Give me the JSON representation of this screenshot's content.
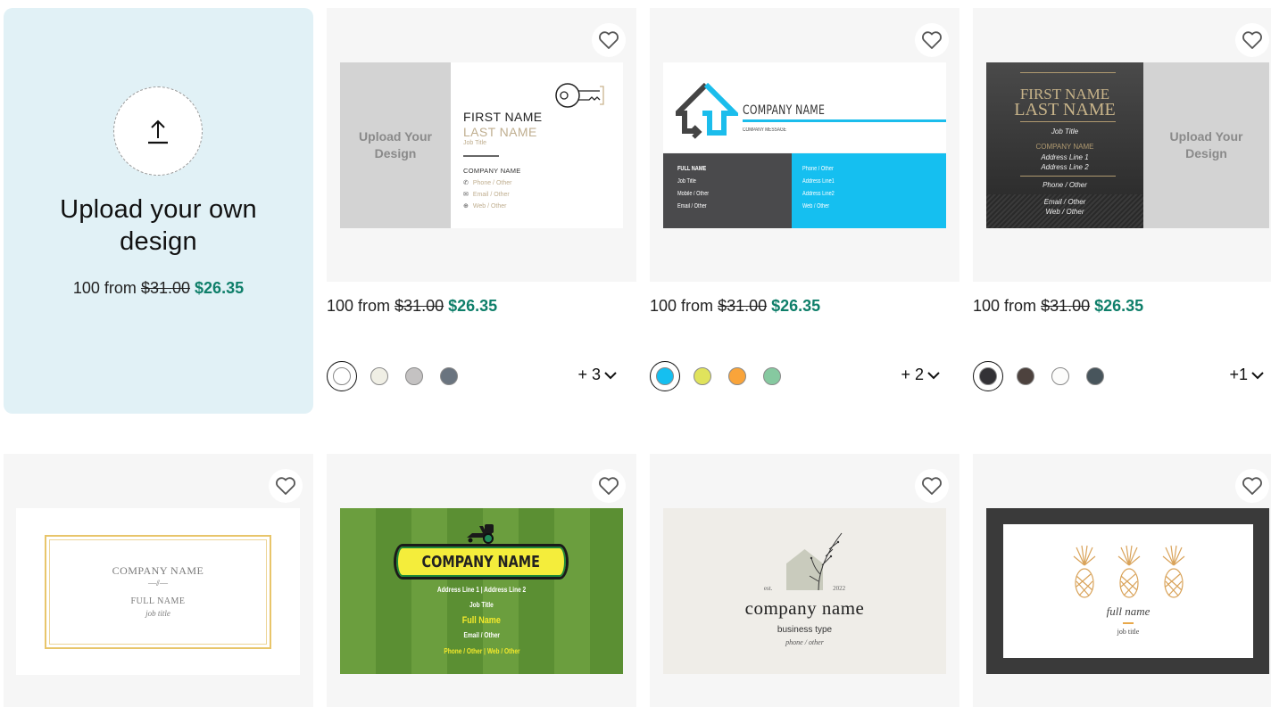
{
  "upload_card": {
    "icon": "upload-icon",
    "title": "Upload your own design",
    "price": {
      "prefix": "100 from",
      "old": "$31.00",
      "new": "$26.35"
    }
  },
  "colors": {
    "upload_bg": "#e1f1f6",
    "sale_price": "#0f7f6a",
    "tile_bg": "#f6f6f6"
  },
  "products": [
    {
      "name": "key-logo-card",
      "price": {
        "prefix": "100 from",
        "old": "$31.00",
        "new": "$26.35"
      },
      "swatches": [
        "#ffffff",
        "#f0efe5",
        "#c4c2c2",
        "#6a747f"
      ],
      "selected_swatch": 0,
      "more_colors": "+ 3",
      "design": {
        "upload_text": "Upload Your Design",
        "first": "FIRST NAME",
        "last": "LAST NAME",
        "job": "Job Title",
        "company": "COMPANY NAME",
        "phone": "Phone / Other",
        "email": "Email / Other",
        "web": "Web / Other"
      }
    },
    {
      "name": "house-arrow-card",
      "price": {
        "prefix": "100 from",
        "old": "$31.00",
        "new": "$26.35"
      },
      "swatches": [
        "#15bff0",
        "#e0e35c",
        "#f9a43a",
        "#86c9a0"
      ],
      "selected_swatch": 0,
      "more_colors": "+ 2",
      "design": {
        "company": "COMPANY NAME",
        "message": "COMPANY MESSAGE",
        "left": [
          "FULL NAME",
          "Job Title",
          "Mobile / Other",
          "Email / Other"
        ],
        "right": [
          "Phone / Other",
          "Address Line1",
          "Address Line2",
          "Web / Other"
        ]
      }
    },
    {
      "name": "dark-gold-card",
      "price": {
        "prefix": "100 from",
        "old": "$31.00",
        "new": "$26.35"
      },
      "swatches": [
        "#333236",
        "#4d423e",
        "#fcfcfb",
        "#48555c"
      ],
      "selected_swatch": 0,
      "more_colors": "+1",
      "design": {
        "first": "FIRST NAME",
        "last": "LAST NAME",
        "job": "Job Title",
        "company": "COMPANY NAME",
        "address1": "Address Line 1",
        "address2": "Address Line 2",
        "phone": "Phone / Other",
        "email": "Email / Other",
        "web": "Web / Other",
        "upload_text": "Upload Your Design"
      }
    },
    {
      "name": "gold-frame-card",
      "design": {
        "company": "COMPANY NAME",
        "divider": "—⫽—",
        "full_name": "FULL NAME",
        "job": "job title"
      }
    },
    {
      "name": "lawn-mower-card",
      "design": {
        "company": "COMPANY NAME",
        "address": "Address Line 1 | Address Line 2",
        "job": "Job Title",
        "full_name": "Full Name",
        "email": "Email / Other",
        "contact": "Phone / Other | Web / Other"
      }
    },
    {
      "name": "botanical-house-card",
      "design": {
        "est": "est.",
        "year": "2022",
        "company": "company name",
        "business": "business type",
        "phone": "phone / other"
      }
    },
    {
      "name": "pineapple-card",
      "design": {
        "full_name": "full name",
        "job": "job title"
      }
    }
  ],
  "favorite_icon": "heart-outline-icon"
}
